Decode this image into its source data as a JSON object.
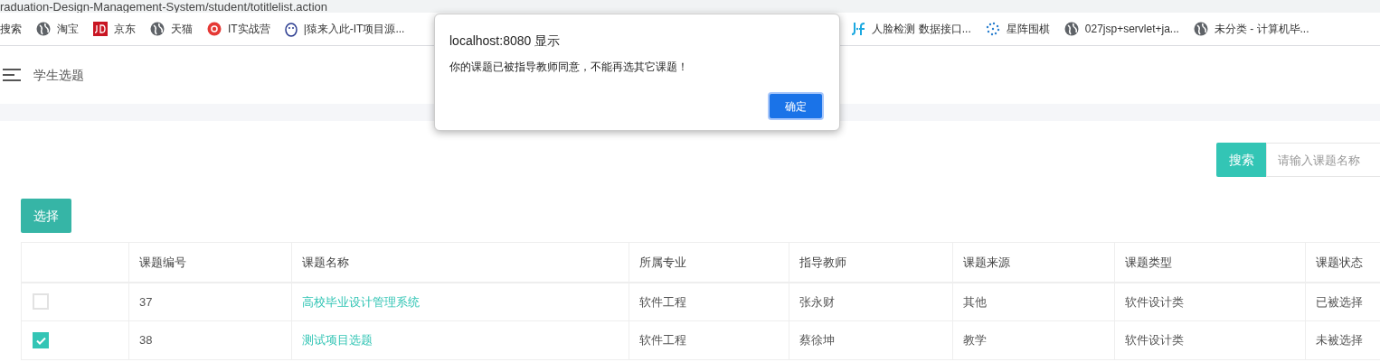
{
  "address_bar": {
    "url": "raduation-Design-Management-System/student/totitlelist.action"
  },
  "bookmarks": [
    {
      "label": "搜索",
      "kind": "none"
    },
    {
      "label": "淘宝",
      "kind": "globe"
    },
    {
      "label": "京东",
      "kind": "jd"
    },
    {
      "label": "天猫",
      "kind": "globe"
    },
    {
      "label": "IT实战营",
      "kind": "chrome"
    },
    {
      "label": "|猿来入此-IT项目源...",
      "kind": "mascot"
    },
    {
      "label": "人脸检测 数据接口...",
      "kind": "jf"
    },
    {
      "label": "星阵围棋",
      "kind": "dots"
    },
    {
      "label": "027jsp+servlet+ja...",
      "kind": "globe"
    },
    {
      "label": "未分类 - 计算机毕...",
      "kind": "globe"
    }
  ],
  "page_header": {
    "title": "学生选题"
  },
  "search": {
    "button": "搜索",
    "placeholder": "请输入课题名称"
  },
  "select_button": "选择",
  "table": {
    "columns": [
      "课题编号",
      "课题名称",
      "所属专业",
      "指导教师",
      "课题来源",
      "课题类型",
      "课题状态"
    ],
    "rows": [
      {
        "checked": false,
        "cells": [
          "37",
          "高校毕业设计管理系统",
          "软件工程",
          "张永财",
          "其他",
          "软件设计类",
          "已被选择"
        ]
      },
      {
        "checked": true,
        "cells": [
          "38",
          "测试项目选题",
          "软件工程",
          "蔡徐坤",
          "教学",
          "软件设计类",
          "未被选择"
        ]
      }
    ]
  },
  "dialog": {
    "title": "localhost:8080 显示",
    "message": "你的课题已被指导教师同意，不能再选其它课题！",
    "ok_button": "确定"
  }
}
